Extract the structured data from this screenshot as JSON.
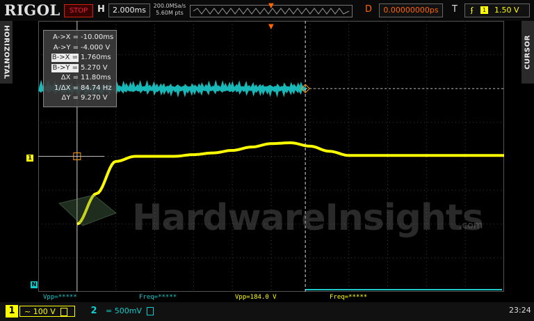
{
  "brand": "RIGOL",
  "status": "STOP",
  "horizontal": {
    "label": "H",
    "timebase": "2.000ms",
    "sample_rate": "200.0MSa/s",
    "memory_depth": "5.60M pts",
    "delay_label": "D",
    "delay": "0.00000000ps"
  },
  "trigger": {
    "label": "T",
    "level": "1.50 V",
    "source_icon": "ch1-icon",
    "edge_icon": "rising-edge-icon"
  },
  "side_tabs": {
    "left": "HORIZONTAL",
    "right": "CURSOR"
  },
  "cursor_table": [
    {
      "key": "A->X =",
      "value": "-10.00ms",
      "boxed": false
    },
    {
      "key": "A->Y =",
      "value": "-4.000 V",
      "boxed": false
    },
    {
      "key": "B->X =",
      "value": "1.760ms",
      "boxed": true
    },
    {
      "key": "B->Y =",
      "value": "5.270 V",
      "boxed": true
    },
    {
      "key": "ΔX =",
      "value": "11.80ms",
      "boxed": false
    },
    {
      "key": "1/ΔX =",
      "value": "84.74 Hz",
      "boxed": false
    },
    {
      "key": "ΔY =",
      "value": "9.270 V",
      "boxed": false
    }
  ],
  "watermark": {
    "text": "HardwareInsights",
    "suffix": ".com"
  },
  "markers": {
    "ch1": "1",
    "ch2": "N"
  },
  "measurements": [
    {
      "label": "Vpp=*****",
      "color": "#1cc"
    },
    {
      "label": "Freq=*****",
      "color": "#1cc"
    },
    {
      "label": "Vpp=184.0 V",
      "color": "#ff0"
    },
    {
      "label": "Freq=*****",
      "color": "#ff0"
    }
  ],
  "channels": [
    {
      "num": "1",
      "coupling": "~",
      "scale": "100 V",
      "color": "#ffff00"
    },
    {
      "num": "2",
      "coupling": "=",
      "scale": "500mV",
      "color": "#1ccccc"
    }
  ],
  "clock": "23:24",
  "colors": {
    "ch1": "#ffff00",
    "ch2": "#1ccccc",
    "trigger": "#ff6600",
    "grid": "#3a3a3a"
  },
  "chart_data": {
    "type": "line",
    "x": [
      -10,
      -9,
      -8,
      -7,
      -6,
      -5,
      -4,
      -3,
      -2,
      -1,
      0,
      1,
      2,
      3,
      4
    ],
    "series": [
      {
        "values": [
          -4.0,
          -2.2,
          -0.3,
          0.0,
          0.0,
          0.0,
          0.1,
          0.2,
          0.35,
          0.55,
          0.75,
          0.8,
          0.6,
          0.3,
          0.05
        ]
      },
      {
        "values": [
          4.0,
          4.0,
          4.0,
          4.0,
          4.0,
          4.0,
          4.0,
          4.0,
          4.0,
          4.0,
          4.0,
          4.0,
          4.0,
          4.0,
          4.0
        ]
      }
    ],
    "xlim": [
      -12,
      12
    ],
    "ylim": [
      -8,
      8
    ],
    "grid": true
  }
}
